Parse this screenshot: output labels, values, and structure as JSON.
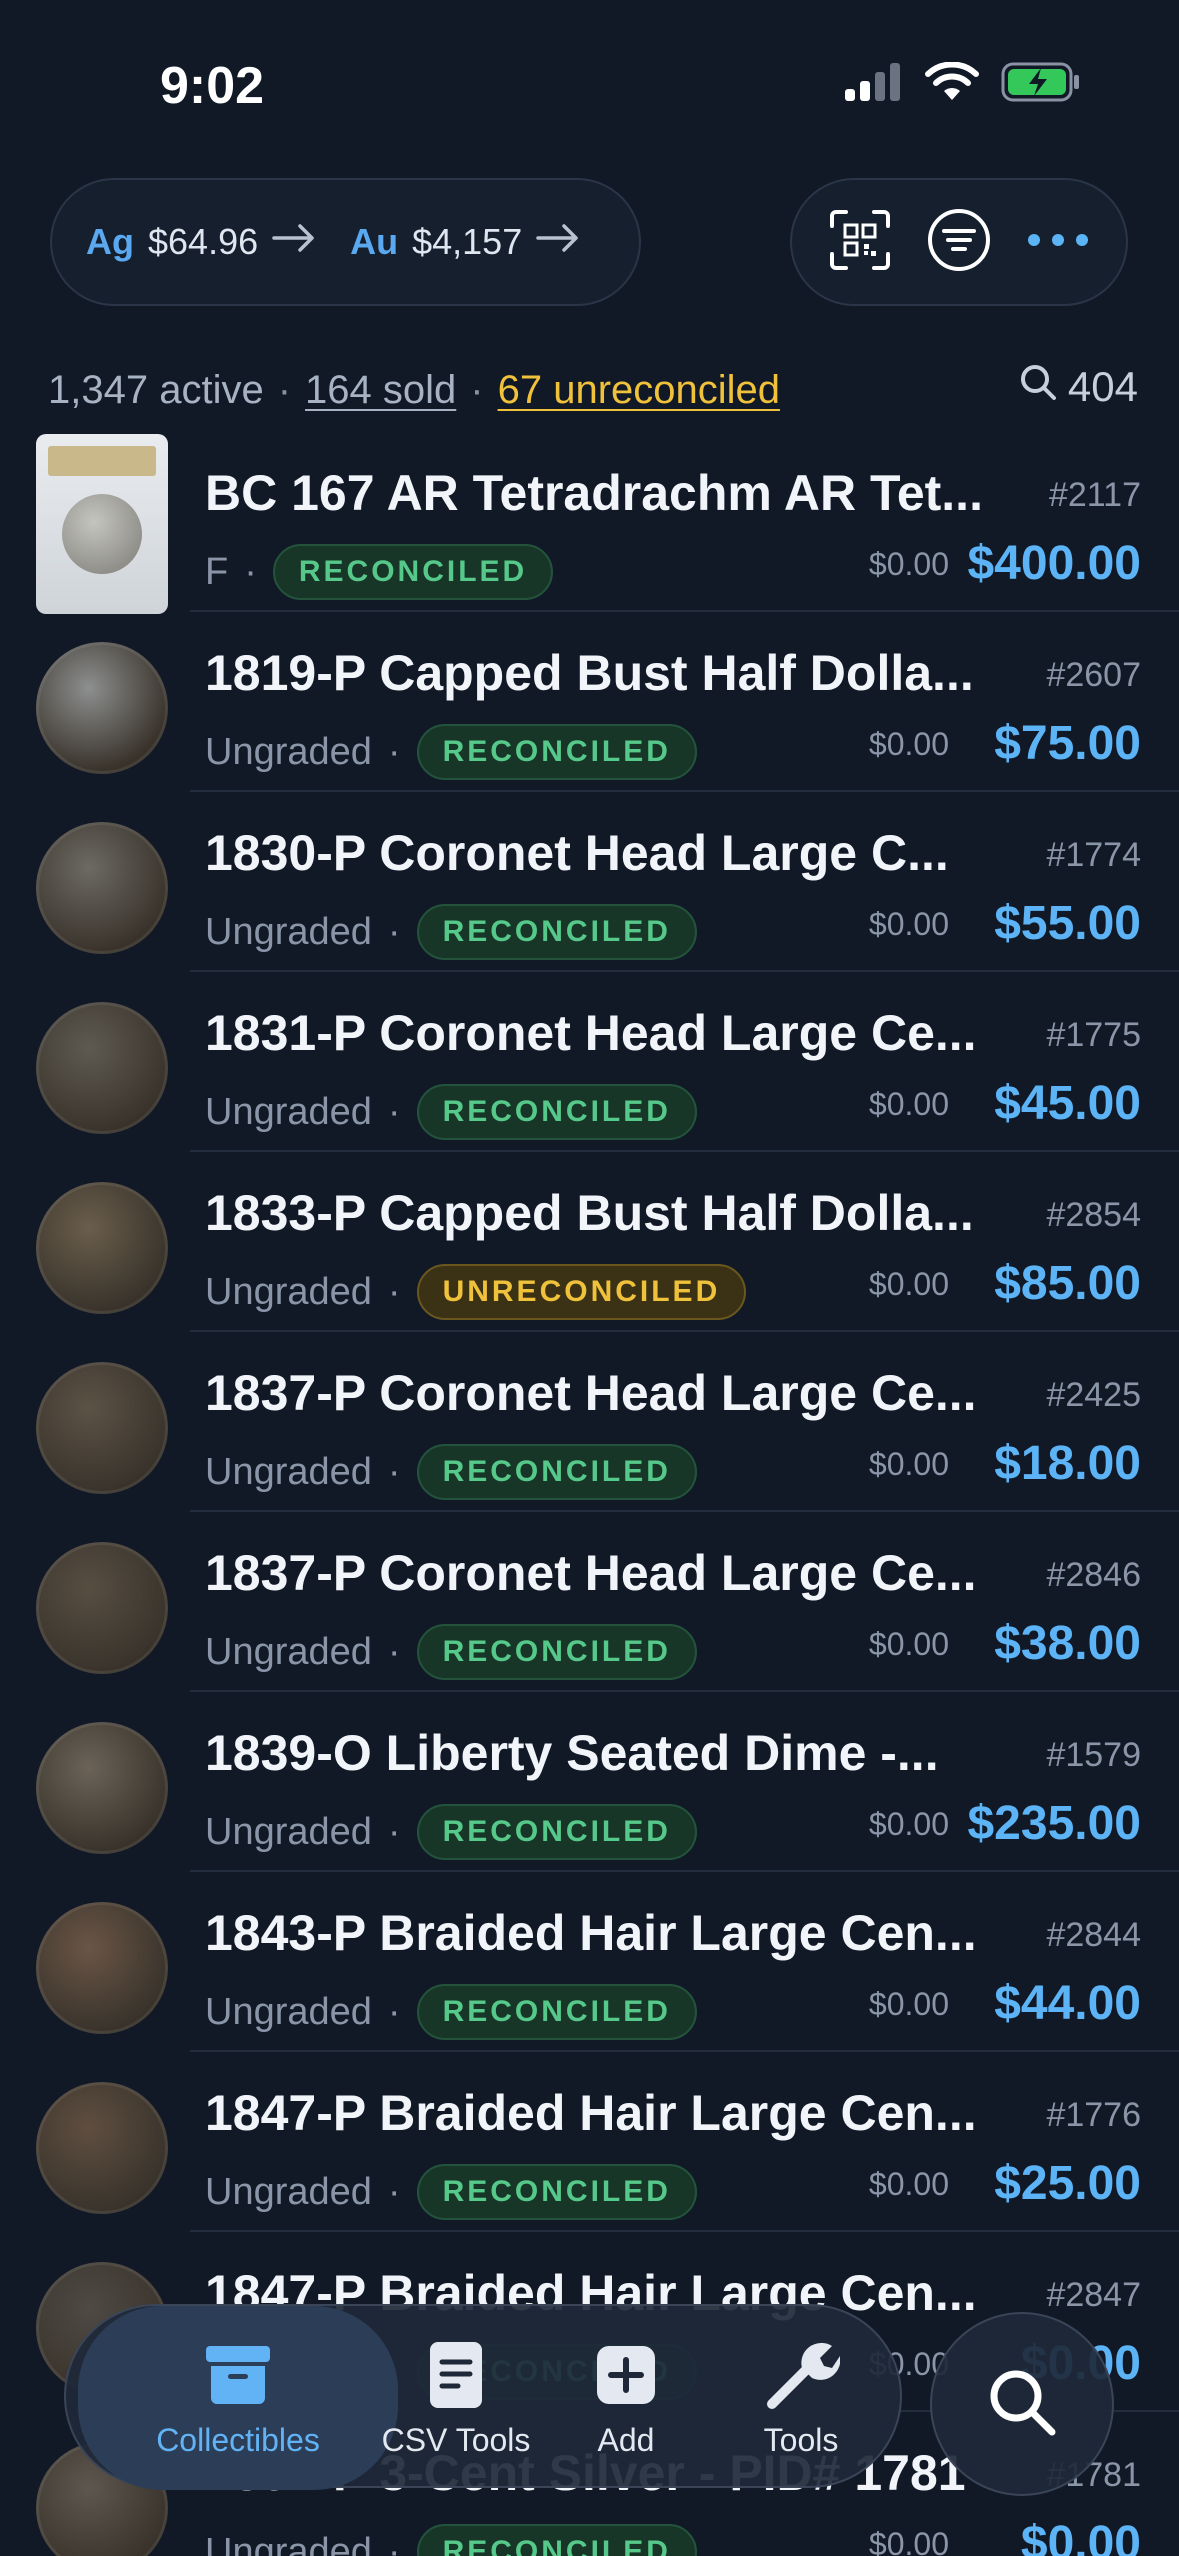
{
  "status": {
    "time": "9:02"
  },
  "spot": {
    "silver_label": "Ag",
    "silver_price": "$64.96",
    "gold_label": "Au",
    "gold_price": "$4,157"
  },
  "summary": {
    "active": "1,347 active",
    "sold": "164 sold",
    "unreconciled": "67 unreconciled",
    "search_count": "404"
  },
  "items": [
    {
      "title": "BC 167 AR Tetradrachm AR Tet...",
      "number": "#2117",
      "grade": "F",
      "status": "RECONCILED",
      "cost": "$0.00",
      "value": "$400.00"
    },
    {
      "title": "1819-P Capped Bust Half Dolla...",
      "number": "#2607",
      "grade": "Ungraded",
      "status": "RECONCILED",
      "cost": "$0.00",
      "value": "$75.00"
    },
    {
      "title": "1830-P Coronet Head Large C...",
      "number": "#1774",
      "grade": "Ungraded",
      "status": "RECONCILED",
      "cost": "$0.00",
      "value": "$55.00"
    },
    {
      "title": "1831-P Coronet Head Large Ce...",
      "number": "#1775",
      "grade": "Ungraded",
      "status": "RECONCILED",
      "cost": "$0.00",
      "value": "$45.00"
    },
    {
      "title": "1833-P Capped Bust Half Dolla...",
      "number": "#2854",
      "grade": "Ungraded",
      "status": "UNRECONCILED",
      "cost": "$0.00",
      "value": "$85.00"
    },
    {
      "title": "1837-P Coronet Head Large Ce...",
      "number": "#2425",
      "grade": "Ungraded",
      "status": "RECONCILED",
      "cost": "$0.00",
      "value": "$18.00"
    },
    {
      "title": "1837-P Coronet Head Large Ce...",
      "number": "#2846",
      "grade": "Ungraded",
      "status": "RECONCILED",
      "cost": "$0.00",
      "value": "$38.00"
    },
    {
      "title": "1839-O Liberty Seated Dime -...",
      "number": "#1579",
      "grade": "Ungraded",
      "status": "RECONCILED",
      "cost": "$0.00",
      "value": "$235.00"
    },
    {
      "title": "1843-P Braided Hair Large Cen...",
      "number": "#2844",
      "grade": "Ungraded",
      "status": "RECONCILED",
      "cost": "$0.00",
      "value": "$44.00"
    },
    {
      "title": "1847-P Braided Hair Large Cen...",
      "number": "#1776",
      "grade": "Ungraded",
      "status": "RECONCILED",
      "cost": "$0.00",
      "value": "$25.00"
    },
    {
      "title": "1847-P Braided Hair Large Cen...",
      "number": "#2847",
      "grade": "Ungraded",
      "status": "RECONCILED",
      "cost": "$0.00",
      "value": "$0.00"
    },
    {
      "title": "1852-P 3-Cent Silver - PID# 1781",
      "number": "#1781",
      "grade": "Ungraded",
      "status": "RECONCILED",
      "cost": "$0.00",
      "value": "$0.00"
    }
  ],
  "tabs": {
    "collectibles": "Collectibles",
    "csv_tools": "CSV Tools",
    "add": "Add",
    "tools": "Tools"
  },
  "colors": {
    "accent": "#5cb4f6",
    "reconciled": "#56c98a",
    "unreconciled": "#f0c13a",
    "background": "#111927"
  }
}
